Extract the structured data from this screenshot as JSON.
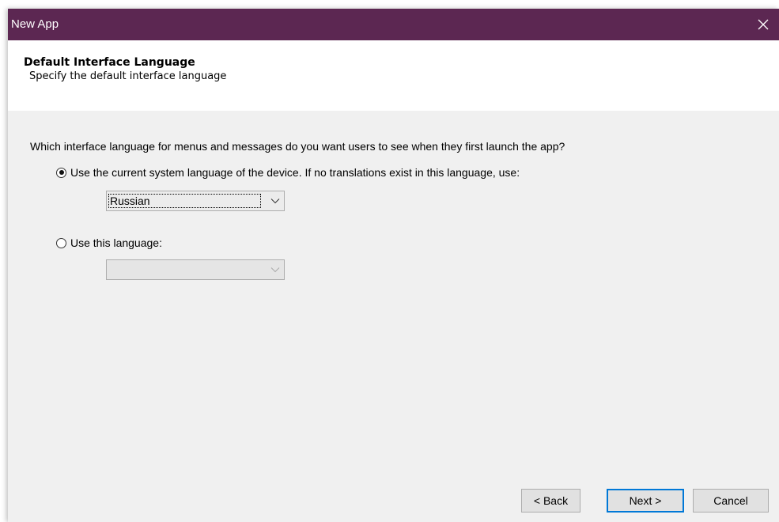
{
  "window": {
    "title": "New App",
    "close_icon": "close-icon",
    "title_bar_color": "#5c2752"
  },
  "header": {
    "title": "Default Interface Language",
    "subtitle": "Specify the default interface language"
  },
  "content": {
    "question": "Which interface language for menus and messages do you want users to see when they first launch the app?",
    "option_system": {
      "label": "Use the current system language of the device. If no translations exist in this language, use:",
      "selected": true,
      "fallback_value": "Russian"
    },
    "option_fixed": {
      "label": "Use this language:",
      "selected": false,
      "value": ""
    }
  },
  "buttons": {
    "back": "< Back",
    "next": "Next >",
    "cancel": "Cancel"
  }
}
